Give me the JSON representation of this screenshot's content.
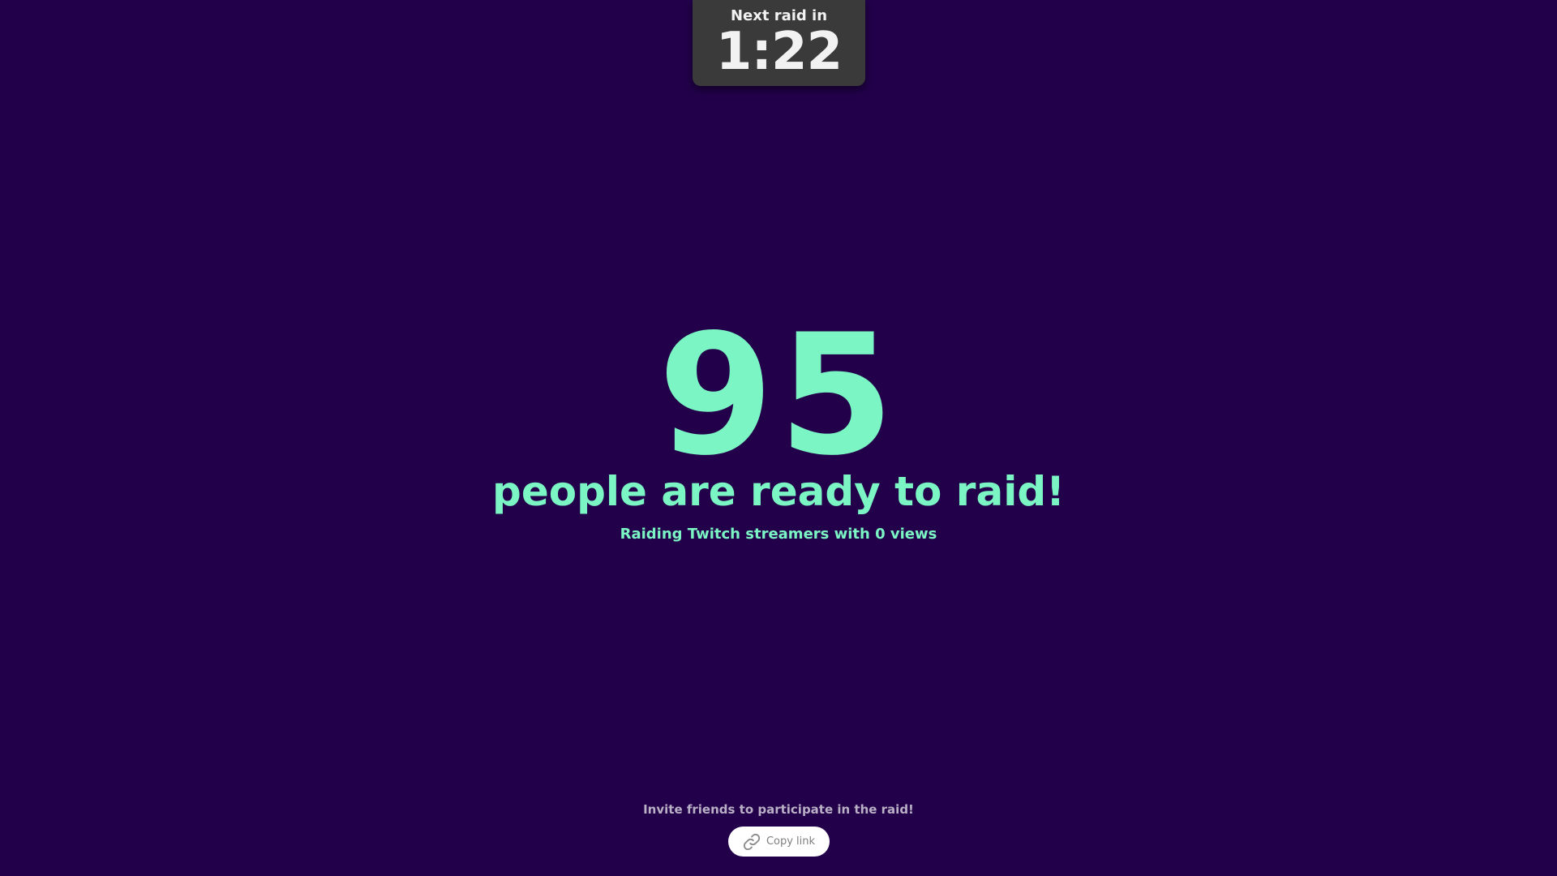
{
  "timer": {
    "label": "Next raid in",
    "value": "1:22"
  },
  "main": {
    "count": "95",
    "headline": "people are ready to raid!",
    "subline": "Raiding Twitch streamers with 0 views"
  },
  "footer": {
    "invite_text": "Invite friends to participate in the raid!",
    "copy_button_label": "Copy link",
    "copy_icon": "link-icon"
  },
  "colors": {
    "background": "#22004a",
    "accent": "#7af5c3",
    "timer_box": "#3a3a3a",
    "timer_text": "#f2f2f2",
    "muted_text": "#b9b0c6",
    "button_bg": "#ffffff",
    "button_text": "#7f7f7f"
  }
}
